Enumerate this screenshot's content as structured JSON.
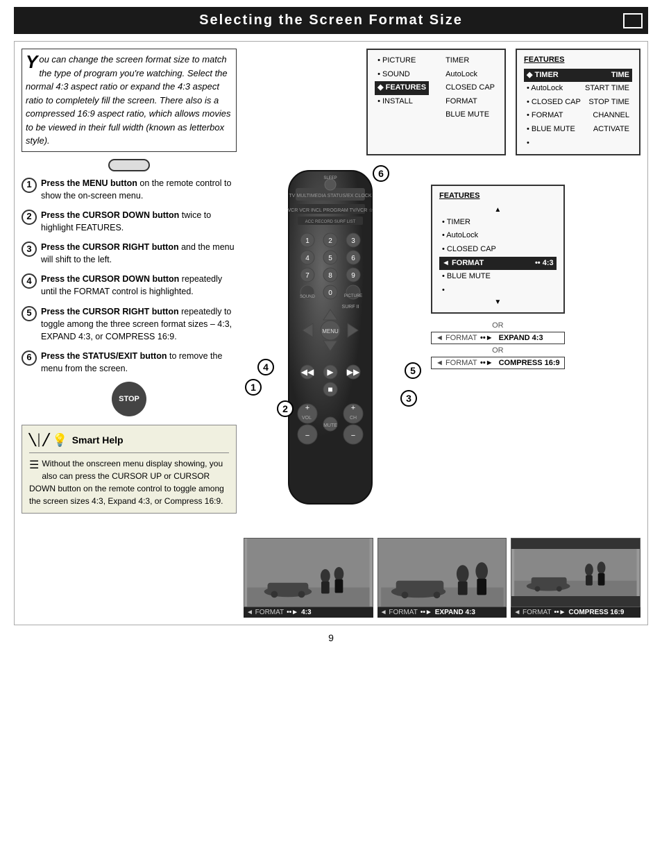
{
  "page": {
    "title": "Selecting the Screen Format Size",
    "page_number": "9"
  },
  "intro": {
    "drop_cap": "Y",
    "text": "ou can change the screen format size to match the type of program you're watching. Select the normal 4:3 aspect ratio or expand the 4:3 aspect ratio to completely fill the screen. There also is a compressed 16:9 aspect ratio, which allows movies to be viewed in their full width (known as letterbox style)."
  },
  "steps": [
    {
      "num": "1",
      "bold": "Press the MENU button",
      "rest": " on the remote control to show the on-screen menu."
    },
    {
      "num": "2",
      "bold": "Press the CURSOR DOWN button",
      "rest": " twice to highlight FEATURES."
    },
    {
      "num": "3",
      "bold": "Press the CURSOR RIGHT button",
      "rest": " and the menu will shift to the left."
    },
    {
      "num": "4",
      "bold": "Press the CURSOR DOWN button",
      "rest": " repeatedly until the FORMAT control is highlighted."
    },
    {
      "num": "5",
      "bold": "Press the CURSOR RIGHT button",
      "rest": " repeatedly to toggle among the three screen format sizes – 4:3, EXPAND 4:3, or COMPRESS 16:9."
    },
    {
      "num": "6",
      "bold": "Press the STATUS/EXIT button",
      "rest": " to remove the menu from the screen."
    }
  ],
  "stop_label": "STOP",
  "smart_help": {
    "title": "Smart Help",
    "text": "Without the onscreen menu display showing, you also can press the CURSOR UP or CURSOR DOWN button on the remote control to toggle among the screen sizes 4:3, Expand 4:3, or Compress 16:9."
  },
  "osd_menu_1": {
    "title": "FEATURES",
    "items": [
      {
        "icon": "◆",
        "label": "TIMER",
        "sub": "TIME",
        "selected": true
      },
      {
        "icon": "•",
        "label": "AutoLock",
        "sub": "START TIME"
      },
      {
        "icon": "•",
        "label": "CLOSED CAP",
        "sub": "STOP TIME"
      },
      {
        "icon": "•",
        "label": "FORMAT",
        "sub": "CHANNEL"
      },
      {
        "icon": "•",
        "label": "BLUE MUTE",
        "sub": "ACTIVATE"
      },
      {
        "icon": "•",
        "label": "",
        "sub": ""
      }
    ]
  },
  "osd_menu_2": {
    "title": "FEATURES",
    "items": [
      {
        "icon": "▲",
        "label": ""
      },
      {
        "icon": "•",
        "label": "TIMER"
      },
      {
        "icon": "•",
        "label": "AutoLock"
      },
      {
        "icon": "•",
        "label": "CLOSED CAP"
      },
      {
        "icon": "◄",
        "label": "FORMAT",
        "right": "••  4:3",
        "selected": true
      },
      {
        "icon": "•",
        "label": "BLUE MUTE"
      },
      {
        "icon": "•",
        "label": ""
      },
      {
        "icon": "▼",
        "label": ""
      }
    ]
  },
  "format_options": [
    {
      "or": false,
      "label": "◄ FORMAT",
      "arrow": "••►",
      "value": "EXPAND 4:3"
    },
    {
      "or": true
    },
    {
      "or": false,
      "label": "◄ FORMAT",
      "arrow": "••►",
      "value": "COMPRESS 16:9"
    }
  ],
  "main_menu_box": {
    "items": [
      {
        "bullet": "•",
        "label": "PICTURE",
        "right": "TIMER"
      },
      {
        "bullet": "•",
        "label": "SOUND",
        "right": "AutoLock"
      },
      {
        "bullet": "◆",
        "label": "FEATURES",
        "right": "CLOSED CAP",
        "selected": true
      },
      {
        "bullet": "•",
        "label": "INSTALL",
        "right": "FORMAT"
      },
      {
        "bullet": "",
        "label": "",
        "right": "BLUE MUTE"
      }
    ]
  },
  "bottom_images": [
    {
      "label": "◄ FORMAT",
      "arrow": "••►",
      "value": "4:3"
    },
    {
      "label": "◄ FORMAT",
      "arrow": "••►",
      "value": "EXPAND 4:3"
    },
    {
      "label": "◄ FORMAT",
      "arrow": "••►",
      "value": "COMPRESS 16:9"
    }
  ]
}
